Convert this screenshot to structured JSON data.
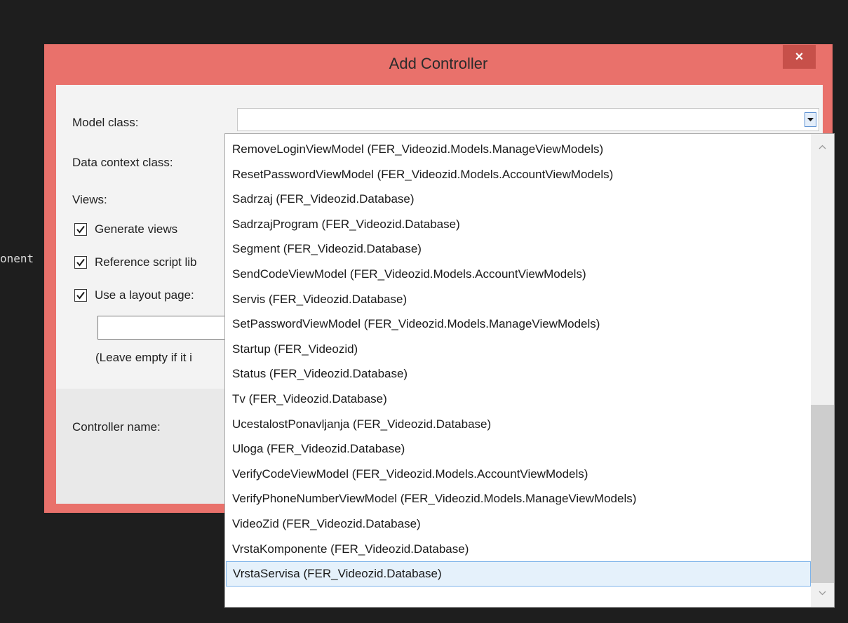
{
  "background": {
    "fragment_text": "onent"
  },
  "dialog": {
    "title": "Add Controller",
    "close_label": "×",
    "model_class_label": "Model class:",
    "model_class_value": "",
    "data_context_label": "Data context class:",
    "views_label": "Views:",
    "generate_views_label": "Generate views",
    "generate_views_checked": true,
    "reference_scripts_label": "Reference script lib",
    "reference_scripts_checked": true,
    "use_layout_label": "Use a layout page:",
    "use_layout_checked": true,
    "layout_value": "",
    "layout_hint": "(Leave empty if it i",
    "controller_name_label": "Controller name:"
  },
  "dropdown": {
    "items": [
      "RemoveLoginViewModel (FER_Videozid.Models.ManageViewModels)",
      "ResetPasswordViewModel (FER_Videozid.Models.AccountViewModels)",
      "Sadrzaj (FER_Videozid.Database)",
      "SadrzajProgram (FER_Videozid.Database)",
      "Segment (FER_Videozid.Database)",
      "SendCodeViewModel (FER_Videozid.Models.AccountViewModels)",
      "Servis (FER_Videozid.Database)",
      "SetPasswordViewModel (FER_Videozid.Models.ManageViewModels)",
      "Startup (FER_Videozid)",
      "Status (FER_Videozid.Database)",
      "Tv (FER_Videozid.Database)",
      "UcestalostPonavljanja (FER_Videozid.Database)",
      "Uloga (FER_Videozid.Database)",
      "VerifyCodeViewModel (FER_Videozid.Models.AccountViewModels)",
      "VerifyPhoneNumberViewModel (FER_Videozid.Models.ManageViewModels)",
      "VideoZid (FER_Videozid.Database)",
      "VrstaKomponente (FER_Videozid.Database)",
      "VrstaServisa (FER_Videozid.Database)"
    ],
    "selected_item": "VrstaServisa (FER_Videozid.Database)"
  },
  "colors": {
    "window_accent": "#e9716b",
    "close_button": "#c7504a",
    "selection_fill": "#e5f1fb",
    "selection_border": "#7eb4ea"
  }
}
